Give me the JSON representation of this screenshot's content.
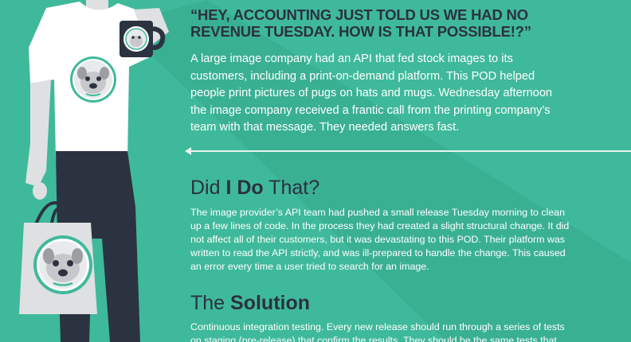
{
  "quote": {
    "title": "“HEY, ACCOUNTING JUST TOLD US WE HAD NO REVENUE TUESDAY. HOW IS THAT POSSIBLE!?”",
    "intro": "A large image company had an API that fed stock images to its customers, including a print-on-demand platform. This POD helped people print pictures of pugs on hats and mugs. Wednesday afternoon the image company received a frantic call from the printing company’s team with that message. They needed answers fast."
  },
  "did_i_do_that": {
    "heading_pre": "Did ",
    "heading_bold": "I Do",
    "heading_post": " That?",
    "body": "The image provider’s API team had pushed a small release Tuesday morning to clean up a few lines of code. In the process they had created a slight structural change. It did not affect all of their customers, but it was devastating to this POD. Their platform was written to read the API strictly, and was ill-prepared to handle the change. This caused an error every time a user tried to search for an image."
  },
  "solution": {
    "heading_pre": "The ",
    "heading_bold": "Solution",
    "body": "Continuous integration testing. Every new release should run through a series of tests on staging (pre-release) that confirm the results. They should be the same tests that"
  },
  "colors": {
    "background": "#3fb99b",
    "heading": "#2b3140",
    "body_text": "#ffffff",
    "figure_gray": "#dfe0e2",
    "figure_dark": "#2c3340",
    "badge_ring": "#3fb99b"
  },
  "icons": [
    "person-figure-illustration",
    "pug-mug-icon",
    "pug-shirt-badge-icon",
    "pug-tote-bag-icon",
    "left-arrow-icon"
  ]
}
